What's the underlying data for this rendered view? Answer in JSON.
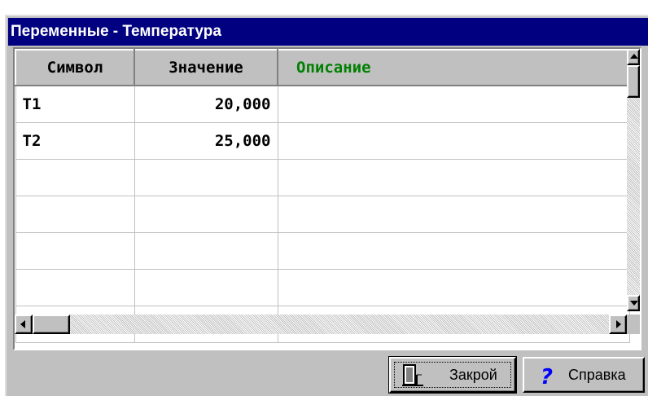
{
  "window": {
    "title": "Переменные - Температура"
  },
  "grid": {
    "columns": [
      {
        "label": "Символ",
        "color": "#000000"
      },
      {
        "label": "Значение",
        "color": "#000000"
      },
      {
        "label": "Описание",
        "color": "#008000"
      }
    ],
    "rows": [
      {
        "symbol": "T1",
        "value": "20,000",
        "description": ""
      },
      {
        "symbol": "T2",
        "value": "25,000",
        "description": ""
      },
      {
        "symbol": "",
        "value": "",
        "description": ""
      },
      {
        "symbol": "",
        "value": "",
        "description": ""
      },
      {
        "symbol": "",
        "value": "",
        "description": ""
      },
      {
        "symbol": "",
        "value": "",
        "description": ""
      },
      {
        "symbol": "",
        "value": "",
        "description": ""
      }
    ]
  },
  "buttons": {
    "close_label": "Закрой",
    "close_icon": "door-exit-icon",
    "help_label": "Справка",
    "help_icon": "question-mark-icon"
  },
  "colors": {
    "titlebar": "#000080",
    "face": "#c0c0c0",
    "accent_header": "#008000",
    "help_icon": "#0000ff"
  }
}
